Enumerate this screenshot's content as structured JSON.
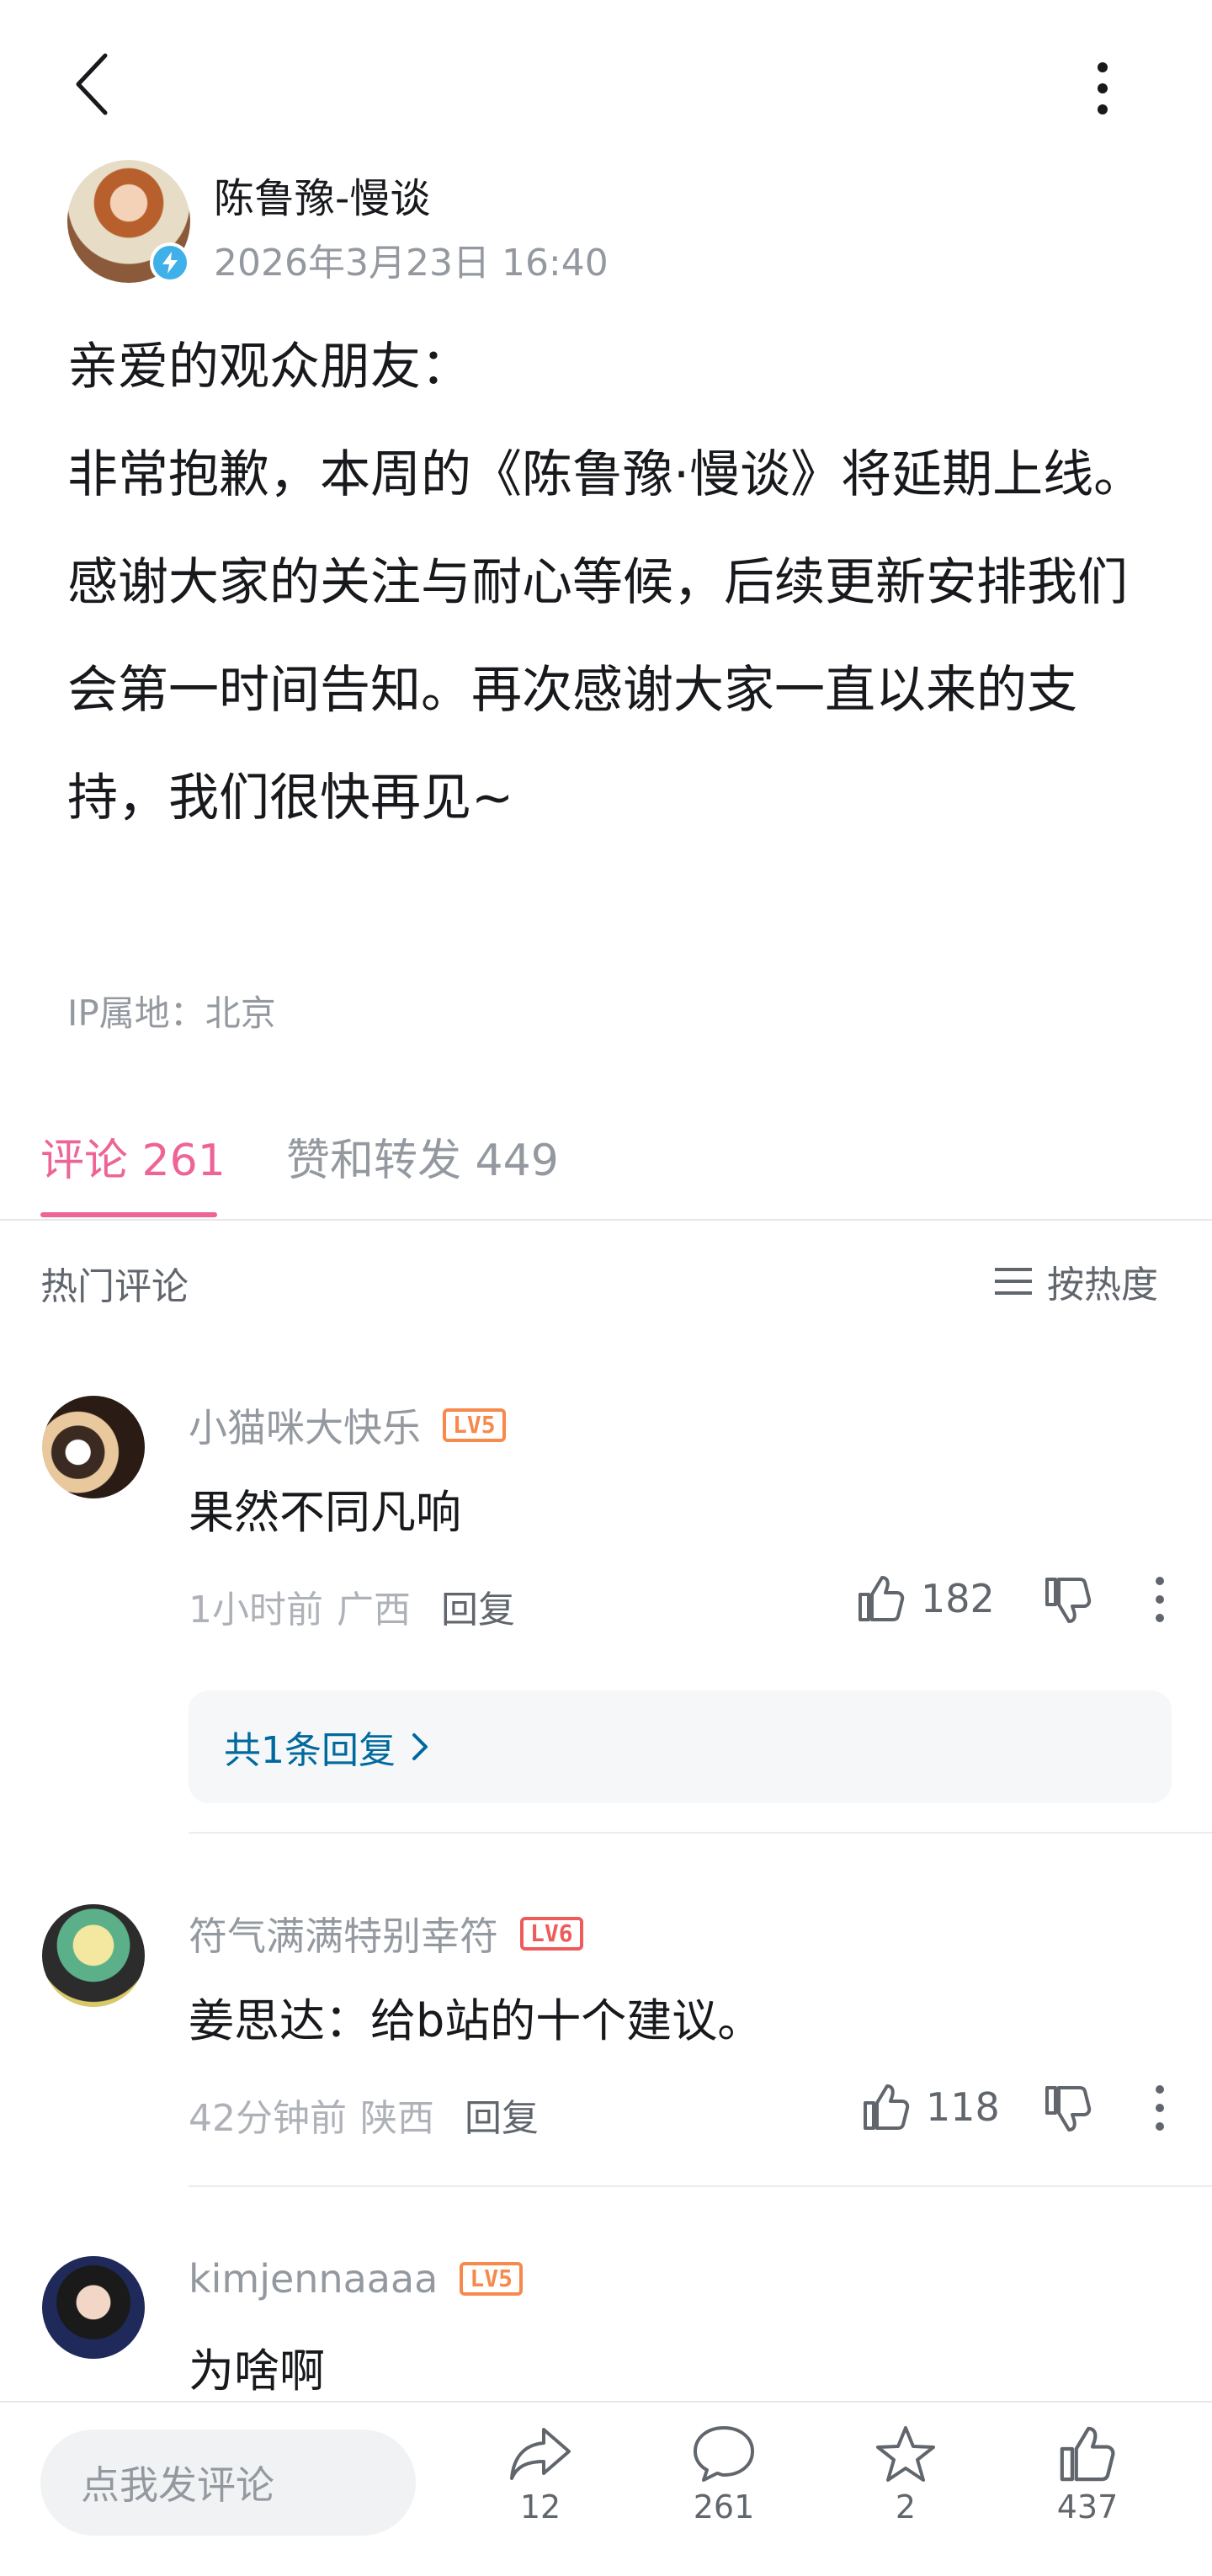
{
  "header": {
    "back_icon": "back-arrow-icon",
    "more_icon": "more-vertical-icon"
  },
  "author": {
    "name": "陈鲁豫-慢谈",
    "time": "2026年3月23日 16:40",
    "verified_color": "#3fb0e8"
  },
  "post": {
    "lines": [
      "亲爱的观众朋友：",
      "非常抱歉，本周的《陈鲁豫·慢谈》将延期上线。",
      "感谢大家的关注与耐心等候，后续更新安排我们会第一时间告知。再次感谢大家一直以来的支持，我们很快再见~"
    ],
    "ip_location": "IP属地：北京"
  },
  "tabs": {
    "comments": "评论 261",
    "likes_reposts": "赞和转发 449",
    "active_color": "#ee6496"
  },
  "section": {
    "hot_label": "热门评论",
    "sort_label": "按热度"
  },
  "comments": [
    {
      "user": "小猫咪大快乐",
      "level": "LV5",
      "level_color": "#f6894b",
      "text": "果然不同凡响",
      "time": "1小时前",
      "location": "广西",
      "reply": "回复",
      "likes": "182",
      "reply_summary": "共1条回复"
    },
    {
      "user": "符气满满特别幸符",
      "level": "LV6",
      "level_color": "#ee5b5b",
      "text": "姜思达：给b站的十个建议。",
      "time": "42分钟前",
      "location": "陕西",
      "reply": "回复",
      "likes": "118"
    },
    {
      "user": "kimjennaaaa",
      "level": "LV5",
      "level_color": "#f6894b",
      "text": "为啥啊"
    }
  ],
  "bottom": {
    "input_placeholder": "点我发评论",
    "share_count": "12",
    "comment_count": "261",
    "favorite_count": "2",
    "like_count": "437"
  }
}
